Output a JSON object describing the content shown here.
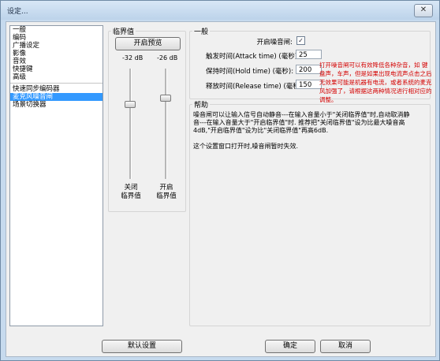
{
  "window": {
    "title": "设定...",
    "close_symbol": "✕"
  },
  "sidebar": {
    "items": [
      "一般",
      "编码",
      "广播设定",
      "影像",
      "音效",
      "快捷键",
      "高级",
      "快速同步编码器",
      "麦克风噪音闸",
      "场景切换器"
    ],
    "selected": "麦克风噪音闸"
  },
  "threshold": {
    "title": "临界值",
    "preview_button": "开启预览",
    "left_db": "-32 dB",
    "right_db": "-26 dB",
    "left_label": "关闭\n临界值",
    "right_label": "开启\n临界值",
    "left_level_db": -32,
    "right_level_db": -26
  },
  "general": {
    "title": "一般",
    "enable_label": "开启噪音闸:",
    "enable_checked": true,
    "attack_label": "触发时间(Attack time) (毫秒):",
    "attack_value": "25",
    "hold_label": "保持时间(Hold time) (毫秒):",
    "hold_value": "200",
    "release_label": "释放时间(Release time) (毫秒):",
    "release_value": "150",
    "note": "打开噪音闸可以有效降低各种杂音，如 键盘声，车声，但是如果出现电流声点击之后无效果可能是机器有电流，或者系统的麦克风加强了，请根据这两种情况进行相对应的调整。"
  },
  "help": {
    "title": "帮助",
    "para1": "噪音闸可以让输入信号自动静音---在输入音量小于\"关闭临界值\"时,自动取消静音---在输入音量大于\"开启临界值\"时. 推荐把\"关闭临界值\"设为比最大噪音高4dB,\"开启临界值\"设为比\"关闭临界值\"再高6dB.",
    "para2": "这个设置窗口打开时,噪音闸暂时失效."
  },
  "footer": {
    "default_button": "默认设置",
    "ok_button": "确定",
    "cancel_button": "取消"
  },
  "colors": {
    "selected": "#3399ff",
    "note": "#d40000"
  }
}
